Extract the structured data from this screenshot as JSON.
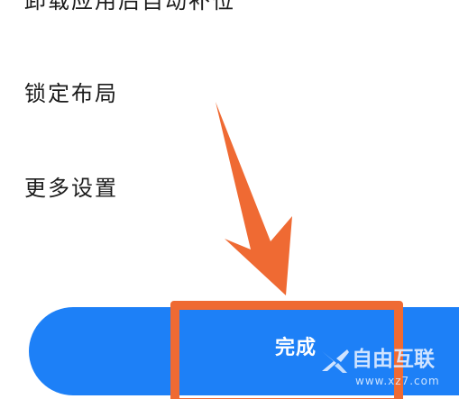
{
  "settings": {
    "items": [
      {
        "label": "卸载应用后自动补位"
      },
      {
        "label": "锁定布局"
      },
      {
        "label": "更多设置"
      }
    ]
  },
  "footer": {
    "done_label": "完成"
  },
  "watermark": {
    "title": "自由互联",
    "url": "www.xz7.com"
  },
  "colors": {
    "button": "#1d80f7",
    "highlight": "#ef6a33",
    "arrow": "#ef6a33",
    "text": "#1c1c1c"
  }
}
